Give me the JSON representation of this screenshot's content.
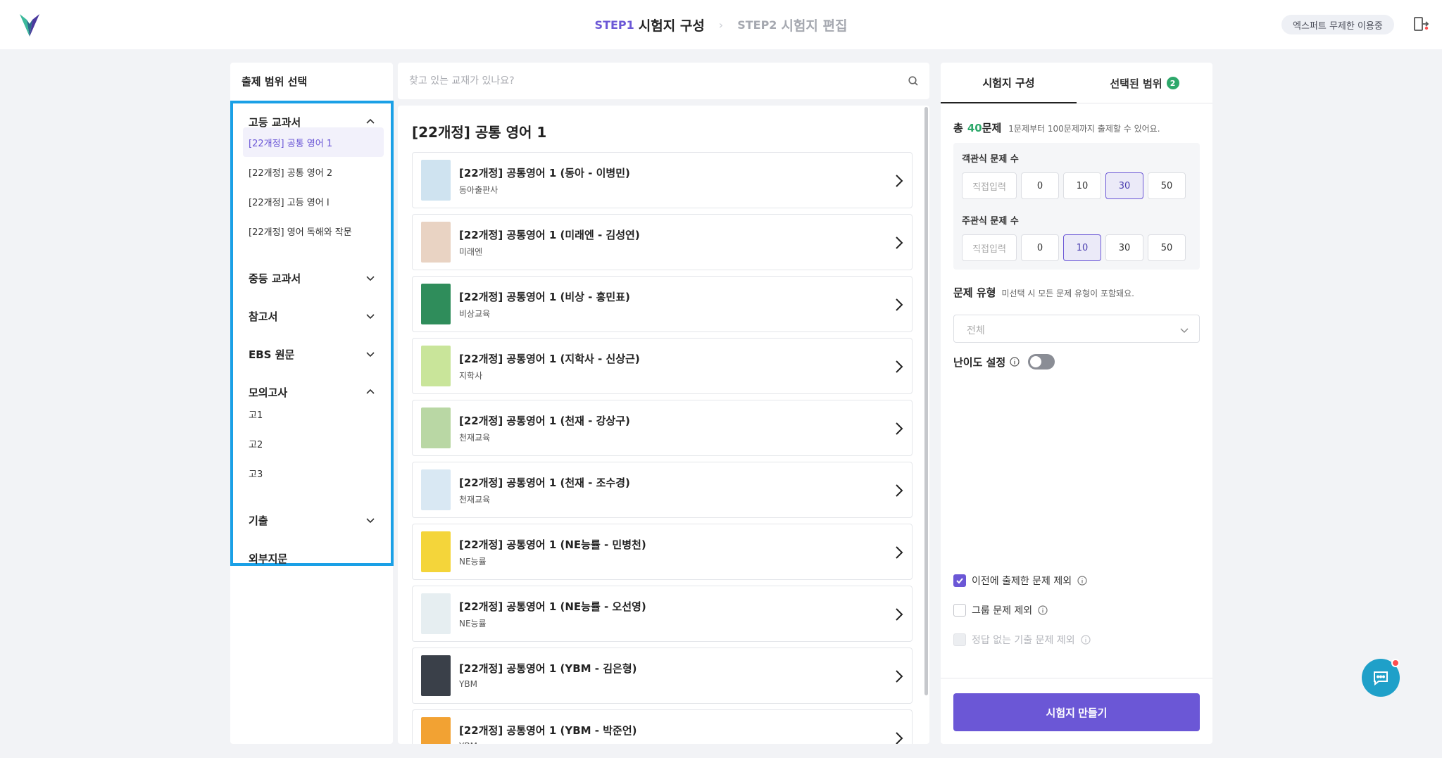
{
  "header": {
    "step1_label": "STEP1",
    "step1_title": "시험지 구성",
    "step2_label": "STEP2",
    "step2_title": "시험지 편집",
    "plan_badge": "엑스퍼트 무제한 이용중"
  },
  "left": {
    "title": "출제 범위 선택",
    "groups": [
      {
        "label": "고등 교과서",
        "expanded": true,
        "items": [
          "[22개정] 공통 영어 1",
          "[22개정] 공통 영어 2",
          "[22개정] 고등 영어 I",
          "[22개정] 영어 독해와 작문"
        ]
      },
      {
        "label": "중등 교과서",
        "expanded": false
      },
      {
        "label": "참고서",
        "expanded": false
      },
      {
        "label": "EBS 원문",
        "expanded": false
      },
      {
        "label": "모의고사",
        "expanded": true,
        "items": [
          "고1",
          "고2",
          "고3"
        ]
      },
      {
        "label": "기출",
        "expanded": false
      },
      {
        "label": "외부지문"
      }
    ],
    "selected_item": "[22개정] 공통 영어 1"
  },
  "search": {
    "placeholder": "찾고 있는 교재가 있나요?"
  },
  "middle": {
    "title": "[22개정] 공통 영어 1",
    "books": [
      {
        "title": "[22개정] 공통영어 1 (동아 - 이병민)",
        "publisher": "동아출판사",
        "cover": "#cfe3f0"
      },
      {
        "title": "[22개정] 공통영어 1 (미래엔 - 김성연)",
        "publisher": "미래엔",
        "cover": "#e9d3c3"
      },
      {
        "title": "[22개정] 공통영어 1 (비상 - 홍민표)",
        "publisher": "비상교육",
        "cover": "#2f8d5b"
      },
      {
        "title": "[22개정] 공통영어 1 (지학사 - 신상근)",
        "publisher": "지학사",
        "cover": "#c9e59a"
      },
      {
        "title": "[22개정] 공통영어 1 (천재 - 강상구)",
        "publisher": "천재교육",
        "cover": "#b9d7a4"
      },
      {
        "title": "[22개정] 공통영어 1 (천재 - 조수경)",
        "publisher": "천재교육",
        "cover": "#d9e8f3"
      },
      {
        "title": "[22개정] 공통영어 1 (NE능률 - 민병천)",
        "publisher": "NE능률",
        "cover": "#f4d53a"
      },
      {
        "title": "[22개정] 공통영어 1 (NE능률 - 오선영)",
        "publisher": "NE능률",
        "cover": "#e6eef1"
      },
      {
        "title": "[22개정] 공통영어 1 (YBM - 김은형)",
        "publisher": "YBM",
        "cover": "#3a4049"
      },
      {
        "title": "[22개정] 공통영어 1 (YBM - 박준언)",
        "publisher": "YBM",
        "cover": "#f2a233"
      }
    ]
  },
  "right": {
    "tab_compose": "시험지 구성",
    "tab_selected": "선택된 범위",
    "tab_selected_count": "2",
    "total_prefix": "총",
    "total_count": "40",
    "total_suffix": "문제",
    "total_hint": "1문제부터 100문제까지 출제할 수 있어요.",
    "objective_label": "객관식 문제 수",
    "subjective_label": "주관식 문제 수",
    "direct_input": "직접입력",
    "options": [
      "0",
      "10",
      "30",
      "50"
    ],
    "objective_selected": "30",
    "subjective_selected": "10",
    "type_label": "문제 유형",
    "type_hint": "미선택 시 모든 문제 유형이 포함돼요.",
    "type_value": "전체",
    "difficulty_label": "난이도 설정",
    "difficulty_on": false,
    "checks": [
      {
        "label": "이전에 출제한 문제 제외",
        "state": "checked"
      },
      {
        "label": "그룹 문제 제외",
        "state": "unchecked"
      },
      {
        "label": "정답 없는 기출 문제 제외",
        "state": "disabled"
      }
    ],
    "make_button": "시험지 만들기"
  },
  "colors": {
    "accent": "#6b57d6",
    "green": "#2ea86b",
    "highlight_border": "#1aa0e6"
  }
}
